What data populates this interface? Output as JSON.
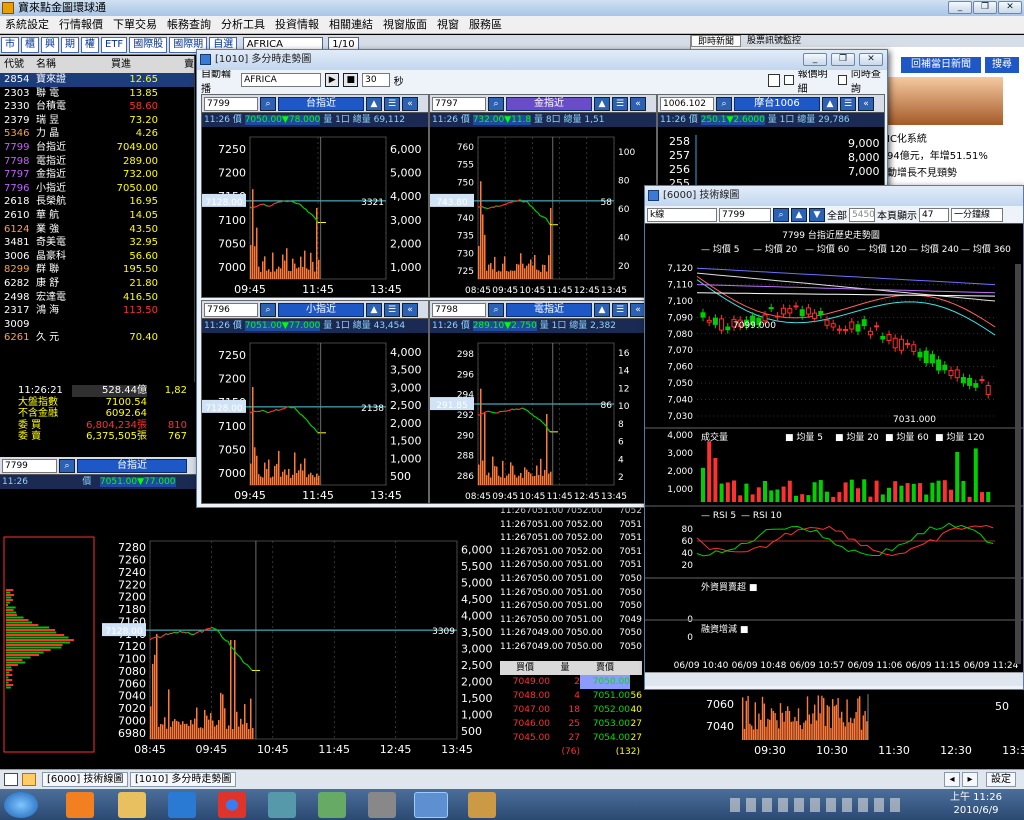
{
  "app": {
    "title": "寶來點金圖環球通"
  },
  "menu": [
    "系統設定",
    "行情報價",
    "下單交易",
    "帳務查詢",
    "分析工具",
    "投資情報",
    "相關連結",
    "視窗版面",
    "視窗",
    "服務區"
  ],
  "toolbar": {
    "tabs": [
      "市",
      "櫃",
      "興",
      "期",
      "權",
      "ETF",
      "國際股",
      "國際期",
      "自選"
    ],
    "market_select": "AFRICA",
    "page": "1/10"
  },
  "quote_table": {
    "headers": [
      "代號",
      "名稱",
      "買進",
      "賣"
    ],
    "rows": [
      {
        "code": "2854",
        "name": "寶來證",
        "bid": "12.65",
        "color": "#ffff00"
      },
      {
        "code": "2303",
        "name": "聯  電",
        "bid": "13.85",
        "color": "#ffff00"
      },
      {
        "code": "2330",
        "name": "台積電",
        "bid": "58.60",
        "color": "#ff3030"
      },
      {
        "code": "2379",
        "name": "瑞  昱",
        "bid": "73.20",
        "color": "#ffff00"
      },
      {
        "code": "5346",
        "name": "力  晶",
        "bid": "4.26",
        "color": "#ffff00"
      },
      {
        "code": "7799",
        "name": "台指近",
        "bid": "7049.00",
        "color": "#ffff00"
      },
      {
        "code": "7798",
        "name": "電指近",
        "bid": "289.00",
        "color": "#ffff00"
      },
      {
        "code": "7797",
        "name": "金指近",
        "bid": "732.00",
        "color": "#ffff00"
      },
      {
        "code": "7796",
        "name": "小指近",
        "bid": "7050.00",
        "color": "#ffff00"
      },
      {
        "code": "2618",
        "name": "長榮航",
        "bid": "16.95",
        "color": "#ffff00"
      },
      {
        "code": "2610",
        "name": "華  航",
        "bid": "14.05",
        "color": "#ffff00"
      },
      {
        "code": "6124",
        "name": "業  強",
        "bid": "43.50",
        "color": "#ffff00"
      },
      {
        "code": "3481",
        "name": "奇美電",
        "bid": "32.95",
        "color": "#ffff00"
      },
      {
        "code": "3006",
        "name": "晶豪科",
        "bid": "56.60",
        "color": "#ffff00"
      },
      {
        "code": "8299",
        "name": "群  聯",
        "bid": "195.50",
        "color": "#ffff00"
      },
      {
        "code": "6282",
        "name": "康  舒",
        "bid": "21.80",
        "color": "#ffff00"
      },
      {
        "code": "2498",
        "name": "宏達電",
        "bid": "416.50",
        "color": "#ffff00"
      },
      {
        "code": "2317",
        "name": "鴻  海",
        "bid": "113.50",
        "color": "#ff3030"
      },
      {
        "code": "3009",
        "name": "",
        "bid": "",
        "color": "#ffff00"
      },
      {
        "code": "6261",
        "name": "久  元",
        "bid": "70.40",
        "color": "#ffff00"
      }
    ]
  },
  "summary": {
    "time": "11:26:21",
    "amount": "528.44億",
    "amount2": "1,82",
    "rows": [
      {
        "label": "大盤指數",
        "value": "7100.54"
      },
      {
        "label": "不含金融",
        "value": "6092.64"
      },
      {
        "label": "委  買",
        "value": "6,804,234張",
        "extra": "810"
      },
      {
        "label": "委  賣",
        "value": "6,375,505張",
        "extra": "767"
      }
    ]
  },
  "big_chart": {
    "code": "7799",
    "name": "台指近",
    "time": "11:26",
    "label": "價",
    "price": "7051.00▼77.000",
    "ref": "7128.00",
    "vol_label": "3309",
    "y_ticks": [
      "7280",
      "7260",
      "7240",
      "7220",
      "7200",
      "7180",
      "7160",
      "7140",
      "7120",
      "7100",
      "7080",
      "7060",
      "7040",
      "7020",
      "7000",
      "6980"
    ],
    "v_ticks": [
      "6,000",
      "5,500",
      "5,000",
      "4,500",
      "4,000",
      "3,500",
      "3,000",
      "2,500",
      "2,000",
      "1,500",
      "1,000",
      "500"
    ],
    "x_ticks": [
      "08:45",
      "09:45",
      "10:45",
      "11:45",
      "12:45",
      "13:45"
    ]
  },
  "ticks": [
    [
      "11:26",
      "7051.00",
      "7052.00",
      "7052"
    ],
    [
      "11:26",
      "7051.00",
      "7052.00",
      "7051"
    ],
    [
      "11:26",
      "7051.00",
      "7052.00",
      "7051"
    ],
    [
      "11:26",
      "7051.00",
      "7052.00",
      "7051"
    ],
    [
      "11:26",
      "7050.00",
      "7051.00",
      "7051"
    ],
    [
      "11:26",
      "7050.00",
      "7051.00",
      "7050"
    ],
    [
      "11:26",
      "7050.00",
      "7051.00",
      "7050"
    ],
    [
      "11:26",
      "7050.00",
      "7051.00",
      "7050"
    ],
    [
      "11:26",
      "7050.00",
      "7051.00",
      "7049"
    ],
    [
      "11:26",
      "7049.00",
      "7050.00",
      "7050"
    ],
    [
      "11:26",
      "7049.00",
      "7050.00",
      "7050"
    ]
  ],
  "order_book": {
    "headers": [
      "買價",
      "量",
      "賣價"
    ],
    "rows": [
      {
        "bid": "7049.00",
        "bq": "2",
        "ask": "7050.00",
        "aq": ""
      },
      {
        "bid": "7048.00",
        "bq": "4",
        "ask": "7051.00",
        "aq": "56"
      },
      {
        "bid": "7047.00",
        "bq": "18",
        "ask": "7052.00",
        "aq": "40"
      },
      {
        "bid": "7046.00",
        "bq": "25",
        "ask": "7053.00",
        "aq": "27"
      },
      {
        "bid": "7045.00",
        "bq": "27",
        "ask": "7054.00",
        "aq": "27"
      }
    ],
    "bid_total": "(76)",
    "ask_total": "(132)"
  },
  "news": {
    "tabs": [
      "即時新聞",
      "股票訊號監控"
    ],
    "btn_today": "回補當日新聞",
    "btn_search": "搜尋",
    "lines": [
      "IC化系統",
      "94億元，年增51.51%",
      "動增長不見頸勢"
    ]
  },
  "win1010": {
    "title": "[1010] 多分時走勢圖",
    "auto_label": "自動輪播",
    "auto_value": "AFRICA",
    "interval": "30",
    "sec": "秒",
    "chk1": "報價明細",
    "chk2": "同時查詢",
    "panels": [
      {
        "code": "7799",
        "name": "台指近",
        "time": "11:26",
        "plabel": "價",
        "price": "7050.00▼78.000",
        "qlabel": "量",
        "qty": "1口",
        "vlabel": "總量",
        "total": "69,112",
        "ref": "7128.00",
        "vl": "3321",
        "y": [
          "7250",
          "7200",
          "7150",
          "7100",
          "7050",
          "7000"
        ],
        "v": [
          "6,000",
          "5,000",
          "4,000",
          "3,000",
          "2,000",
          "1,000"
        ],
        "x": [
          "09:45",
          "11:45",
          "13:45"
        ]
      },
      {
        "code": "7797",
        "name": "金指近",
        "time": "11:26",
        "plabel": "價",
        "price": "732.00▼11.8",
        "qlabel": "量",
        "qty": "8口",
        "vlabel": "總量",
        "total": "1,51",
        "ref": "743.80",
        "vl": "58",
        "y": [
          "760",
          "755",
          "750",
          "745",
          "740",
          "735",
          "730",
          "725"
        ],
        "v": [
          "100",
          "80",
          "60",
          "40",
          "20"
        ],
        "x": [
          "08:45",
          "09:45",
          "10:45",
          "11:45",
          "12:45",
          "13:45"
        ]
      },
      {
        "code": "1006.102",
        "name": "摩台1006",
        "time": "11:26",
        "plabel": "價",
        "price": "250.1▼2.6000",
        "qlabel": "量",
        "qty": "1口",
        "vlabel": "總量",
        "total": "29,786",
        "y": [
          "258",
          "257",
          "256",
          "255"
        ],
        "v": [
          "9,000",
          "8,000",
          "7,000"
        ]
      },
      {
        "code": "7796",
        "name": "小指近",
        "time": "11:26",
        "plabel": "價",
        "price": "7051.00▼77.000",
        "qlabel": "量",
        "qty": "1口",
        "vlabel": "總量",
        "total": "43,454",
        "ref": "7128.00",
        "vl": "2138",
        "y": [
          "7250",
          "7200",
          "7150",
          "7100",
          "7050",
          "7000"
        ],
        "v": [
          "4,000",
          "3,500",
          "3,000",
          "2,500",
          "2,000",
          "1,500",
          "1,000",
          "500"
        ],
        "x": [
          "09:45",
          "11:45",
          "13:45"
        ]
      },
      {
        "code": "7798",
        "name": "電指近",
        "time": "11:26",
        "plabel": "價",
        "price": "289.10▼2.750",
        "qlabel": "量",
        "qty": "1口",
        "vlabel": "總量",
        "total": "2,382",
        "ref": "291.85",
        "vl": "86",
        "y": [
          "298",
          "296",
          "294",
          "292",
          "290",
          "288",
          "286"
        ],
        "v": [
          "16",
          "14",
          "12",
          "10",
          "8",
          "6",
          "4",
          "2"
        ],
        "x": [
          "08:45",
          "09:45",
          "10:45",
          "11:45",
          "12:45",
          "13:45"
        ]
      }
    ]
  },
  "win6000": {
    "title": "[6000] 技術線圖",
    "ktype": "k線",
    "code": "7799",
    "all_label": "全部",
    "all_value": "5450",
    "page_label": "本頁顯示",
    "page_value": "47",
    "period": "一分鐘線",
    "chart_title": "7799 台指近歷史走勢圖",
    "ma_legend": [
      "均價 5",
      "均價 20",
      "均價 60",
      "均價 120",
      "均價 240",
      "均價 360"
    ],
    "price_ticks": [
      "7,120",
      "7,110",
      "7,100",
      "7,090",
      "7,080",
      "7,070",
      "7,060",
      "7,050",
      "7,040",
      "7,030"
    ],
    "high_label": "7099.000",
    "low_label": "7031.000",
    "vol_legend": [
      "成交量",
      "均量 5",
      "均量 20",
      "均量 60",
      "均量 120"
    ],
    "vol_ticks": [
      "4,000",
      "3,000",
      "2,000",
      "1,000"
    ],
    "rsi_legend": [
      "RSI 5",
      "RSI 10"
    ],
    "rsi_ticks": [
      "80",
      "60",
      "40",
      "20"
    ],
    "foreign_label": "外資買賣超",
    "foreign_tick": "0",
    "margin_label": "融資增減",
    "margin_tick": "0",
    "x_ticks": [
      "06/09 10:40",
      "06/09 10:48",
      "06/09 10:57",
      "06/09 11:06",
      "06/09 11:15",
      "06/09 11:24"
    ]
  },
  "right_lower": {
    "y": [
      "7060",
      "7040"
    ],
    "v": [
      "50"
    ],
    "x": [
      "09:30",
      "10:30",
      "11:30",
      "12:30",
      "13:30"
    ]
  },
  "status": {
    "tasks": [
      "[6000] 技術線圖",
      "[1010] 多分時走勢圖"
    ],
    "settings": "設定"
  },
  "clock": {
    "time": "上午 11:26",
    "date": "2010/6/9"
  },
  "colors": {
    "accent": "#1e58c6",
    "up": "#ff3030",
    "down": "#00c000",
    "ref_line": "#4fd3e0",
    "volume": "#ff7a3a"
  }
}
